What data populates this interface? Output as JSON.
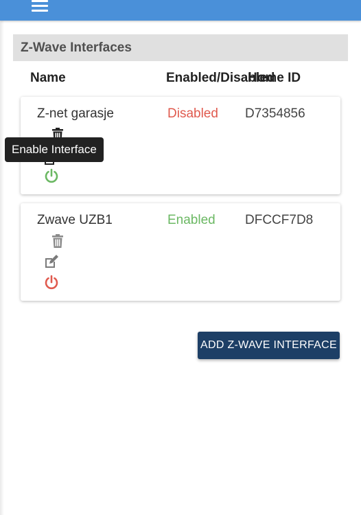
{
  "topbar": {
    "menu_icon": "hamburger-menu-icon",
    "color": "#4a90d9"
  },
  "section": {
    "title": "Z-Wave Interfaces"
  },
  "table": {
    "columns": {
      "name": "Name",
      "status": "Enabled/Disabled",
      "home_id": "Home ID"
    },
    "rows": [
      {
        "name": "Z-net garasje",
        "status": "Disabled",
        "status_color": "#e05a4e",
        "home_id": "D7354856",
        "icons": [
          "trash-icon",
          "edit-icon",
          "power-icon"
        ],
        "power_color": "#6bb863"
      },
      {
        "name": "Zwave UZB1",
        "status": "Enabled",
        "status_color": "#6bb863",
        "home_id": "DFCCF7D8",
        "icons": [
          "trash-icon",
          "edit-icon",
          "power-icon"
        ],
        "power_color": "#e05a4e"
      }
    ]
  },
  "tooltip": {
    "text": "Enable Interface"
  },
  "actions": {
    "add_label": "ADD Z-WAVE INTERFACE",
    "add_color": "#1d3f66"
  }
}
